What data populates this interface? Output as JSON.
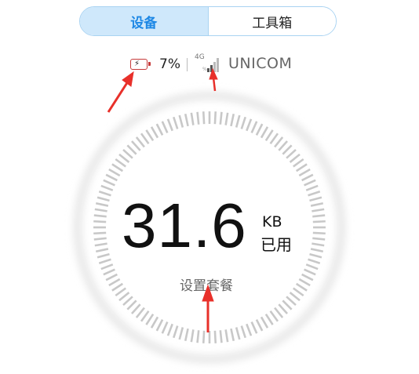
{
  "tabs": [
    {
      "label": "设备",
      "active": true
    },
    {
      "label": "工具箱",
      "active": false
    }
  ],
  "status": {
    "battery_icon": "charging-battery-icon",
    "battery_percent": "7%",
    "network_type": "4G",
    "network_sub": "%",
    "signal_icon": "signal-bars-icon",
    "carrier": "UNICOM"
  },
  "usage": {
    "value": "31.6",
    "unit": "KB",
    "unit_label": "已用"
  },
  "setup_link": "设置套餐",
  "colors": {
    "accent": "#1e88e5",
    "tab_active_bg": "#cfe8fb",
    "battery_low": "#c63a3a",
    "annotation_arrow": "#e8302a",
    "gauge_ticks": "#c8c8c8"
  }
}
